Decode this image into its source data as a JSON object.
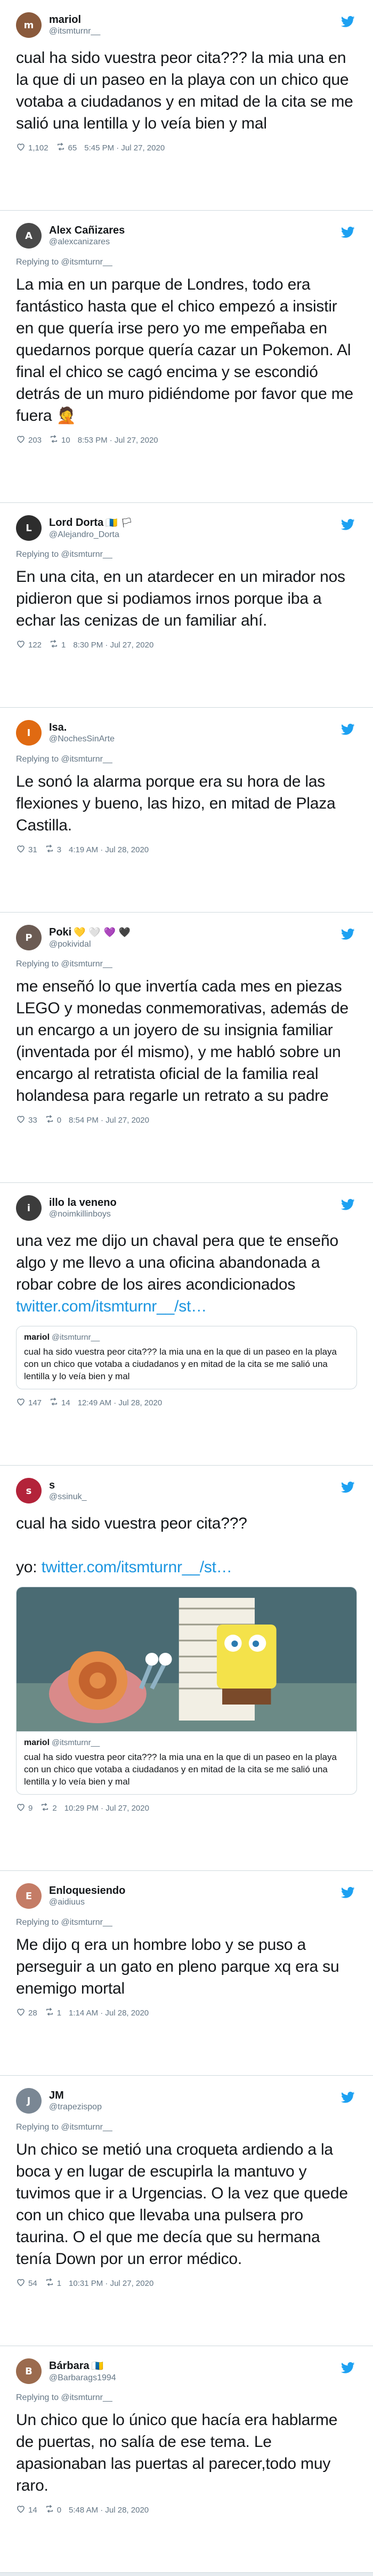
{
  "colors": {
    "link": "#1b95e0",
    "bird": "#1da1f2",
    "muted": "#657786"
  },
  "tweets": [
    {
      "name": "mariol",
      "emoji": "",
      "handle": "@itsmturnr__",
      "reply": false,
      "avatar_color": "#8a5a3c",
      "avatar_letter": "m",
      "text": "cual ha sido vuestra peor cita??? la mia una en la que di un paseo en la playa con un chico que votaba a ciudadanos y en mitad de la cita se me salió una lentilla y lo veía bien y mal",
      "likes": "1,102",
      "retweets": "65",
      "time": "5:45 PM · Jul 27, 2020"
    },
    {
      "name": "Alex Cañizares",
      "emoji": "",
      "handle": "@alexcanizares",
      "reply": true,
      "avatar_color": "#4a4a4a",
      "avatar_letter": "A",
      "text": "La mia en un parque de Londres, todo era fantástico hasta que el chico empezó a insistir en que quería irse pero yo me empeñaba en quedarnos porque quería cazar un Pokemon. Al final el chico se cagó encima y se escondió detrás de un muro pidiéndome por favor que me fuera 🤦",
      "likes": "203",
      "retweets": "10",
      "time": "8:53 PM · Jul 27, 2020"
    },
    {
      "name": "Lord Dorta",
      "emoji": "🇮🇨 🏳",
      "handle": "@Alejandro_Dorta",
      "reply": true,
      "avatar_color": "#2d2d2d",
      "avatar_letter": "L",
      "text": "En una cita, en un atardecer en un mirador nos pidieron que si podiamos irnos porque iba a echar las cenizas de un familiar ahí.",
      "likes": "122",
      "retweets": "1",
      "time": "8:30 PM · Jul 27, 2020"
    },
    {
      "name": "Isa.",
      "emoji": "",
      "handle": "@NochesSinArte",
      "reply": true,
      "avatar_color": "#e06a12",
      "avatar_letter": "I",
      "text": "Le sonó la alarma porque era su hora de las flexiones y bueno, las hizo, en mitad de Plaza Castilla.",
      "likes": "31",
      "retweets": "3",
      "time": "4:19 AM · Jul 28, 2020"
    },
    {
      "name": "Poki",
      "emoji": "💛 🤍 💜 🖤",
      "handle": "@pokividal",
      "reply": true,
      "avatar_color": "#6b5b53",
      "avatar_letter": "P",
      "text": "me enseñó lo que invertía cada mes en piezas LEGO y monedas conmemorativas, además de un encargo a un joyero de su insignia familiar (inventada por él mismo), y me habló sobre un encargo al retratista oficial de la familia real holandesa para regarle un retrato a su padre",
      "likes": "33",
      "retweets": "0",
      "time": "8:54 PM · Jul 27, 2020"
    },
    {
      "name": "illo la veneno",
      "emoji": "",
      "handle": "@noimkillinboys",
      "reply": false,
      "avatar_color": "#3c3c3c",
      "avatar_letter": "i",
      "text": "una vez me dijo un chaval pera que te enseño algo y me llevo a una oficina abandonada a robar cobre de los aires acondicionados",
      "link": "twitter.com/itsmturnr__/st…",
      "quote": {
        "name": "mariol",
        "handle": "@itsmturnr__",
        "text": "cual ha sido vuestra peor cita??? la mia una en la que di un paseo en la playa con un chico que votaba a ciudadanos y en mitad de la cita se me salió una lentilla y lo veía bien y mal"
      },
      "likes": "147",
      "retweets": "14",
      "time": "12:49 AM · Jul 28, 2020"
    },
    {
      "name": "s",
      "emoji": "",
      "handle": "@ssinuk_",
      "reply": false,
      "avatar_color": "#b3233a",
      "avatar_letter": "s",
      "text": "cual ha sido vuestra peor cita???\n\nyo:",
      "link": "twitter.com/itsmturnr__/st…",
      "meme": true,
      "quote": {
        "name": "mariol",
        "handle": "@itsmturnr__",
        "text": "cual ha sido vuestra peor cita??? la mia una en la que di un paseo en la playa con un chico que votaba a ciudadanos y en mitad de la cita se me salió una lentilla y lo veía bien y mal"
      },
      "likes": "9",
      "retweets": "2",
      "time": "10:29 PM · Jul 27, 2020"
    },
    {
      "name": "Enloquesiendo",
      "emoji": "",
      "handle": "@aidiuus",
      "reply": true,
      "avatar_color": "#c47c66",
      "avatar_letter": "E",
      "text": "Me dijo q era un hombre lobo y se puso a perseguir a un gato en pleno parque xq era su enemigo mortal",
      "likes": "28",
      "retweets": "1",
      "time": "1:14 AM · Jul 28, 2020"
    },
    {
      "name": "JM",
      "emoji": "",
      "handle": "@trapezispop",
      "reply": true,
      "avatar_color": "#7a8794",
      "avatar_letter": "J",
      "text": "Un chico se metió una croqueta ardiendo a la boca y en lugar de escupirla la mantuvo y tuvimos que ir a Urgencias. O la vez que quede con un chico que llevaba una pulsera pro taurina. O el que me decía que su hermana tenía Down por un error médico.",
      "likes": "54",
      "retweets": "1",
      "time": "10:31 PM · Jul 27, 2020"
    },
    {
      "name": "Bárbara",
      "emoji": "🇮🇨",
      "handle": "@Barbarags1994",
      "reply": true,
      "avatar_color": "#9b6b4e",
      "avatar_letter": "B",
      "text": "Un chico que lo único que hacía era hablarme de puertas, no salía de ese tema. Le apasionaban las puertas al parecer,todo muy raro.",
      "likes": "14",
      "retweets": "0",
      "time": "5:48 AM · Jul 28, 2020"
    }
  ],
  "reply_prefix": "Replying to",
  "reply_target": "@itsmturnr__"
}
